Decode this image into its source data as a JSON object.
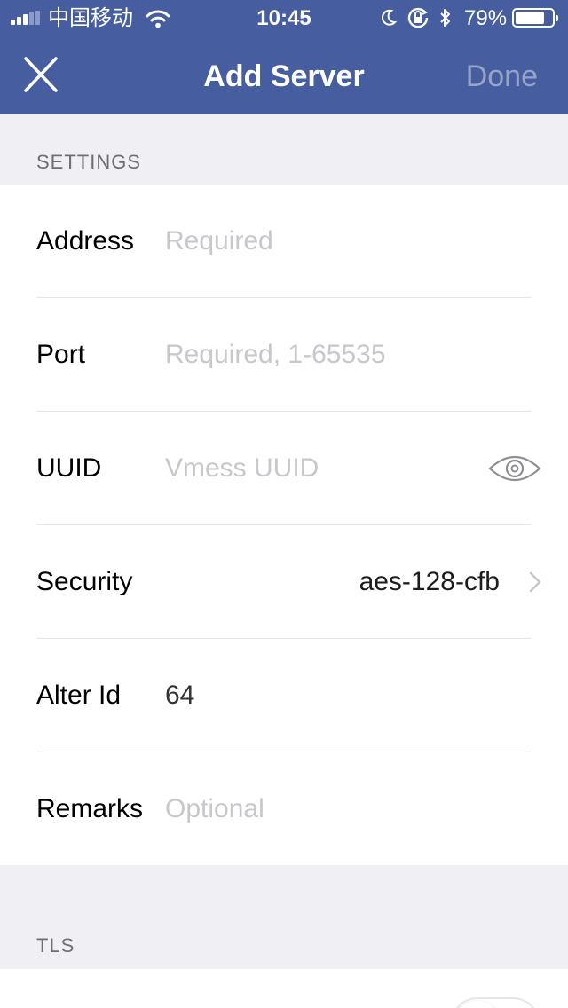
{
  "status_bar": {
    "carrier": "中国移动",
    "time": "10:45",
    "battery": "79%",
    "battery_level": 0.79,
    "icons": [
      "signal-icon",
      "wifi-icon",
      "moon-icon",
      "orientation-lock-icon",
      "bluetooth-icon",
      "battery-icon"
    ]
  },
  "navbar": {
    "title": "Add Server",
    "done_label": "Done",
    "close_icon": "close-icon"
  },
  "colors": {
    "nav_background": "#465ea0",
    "done_disabled": "#97a4c8",
    "page_background": "#efeff4"
  },
  "settings": {
    "header": "SETTINGS",
    "address": {
      "label": "Address",
      "placeholder": "Required"
    },
    "port": {
      "label": "Port",
      "placeholder": "Required, 1-65535"
    },
    "uuid": {
      "label": "UUID",
      "placeholder": "Vmess UUID",
      "icon": "eye-icon"
    },
    "security": {
      "label": "Security",
      "value": "aes-128-cfb",
      "icon": "chevron-right-icon"
    },
    "alter_id": {
      "label": "Alter Id",
      "value": "64"
    },
    "remarks": {
      "label": "Remarks",
      "placeholder": "Optional"
    }
  },
  "tls": {
    "header": "TLS",
    "toggle_on": false
  }
}
